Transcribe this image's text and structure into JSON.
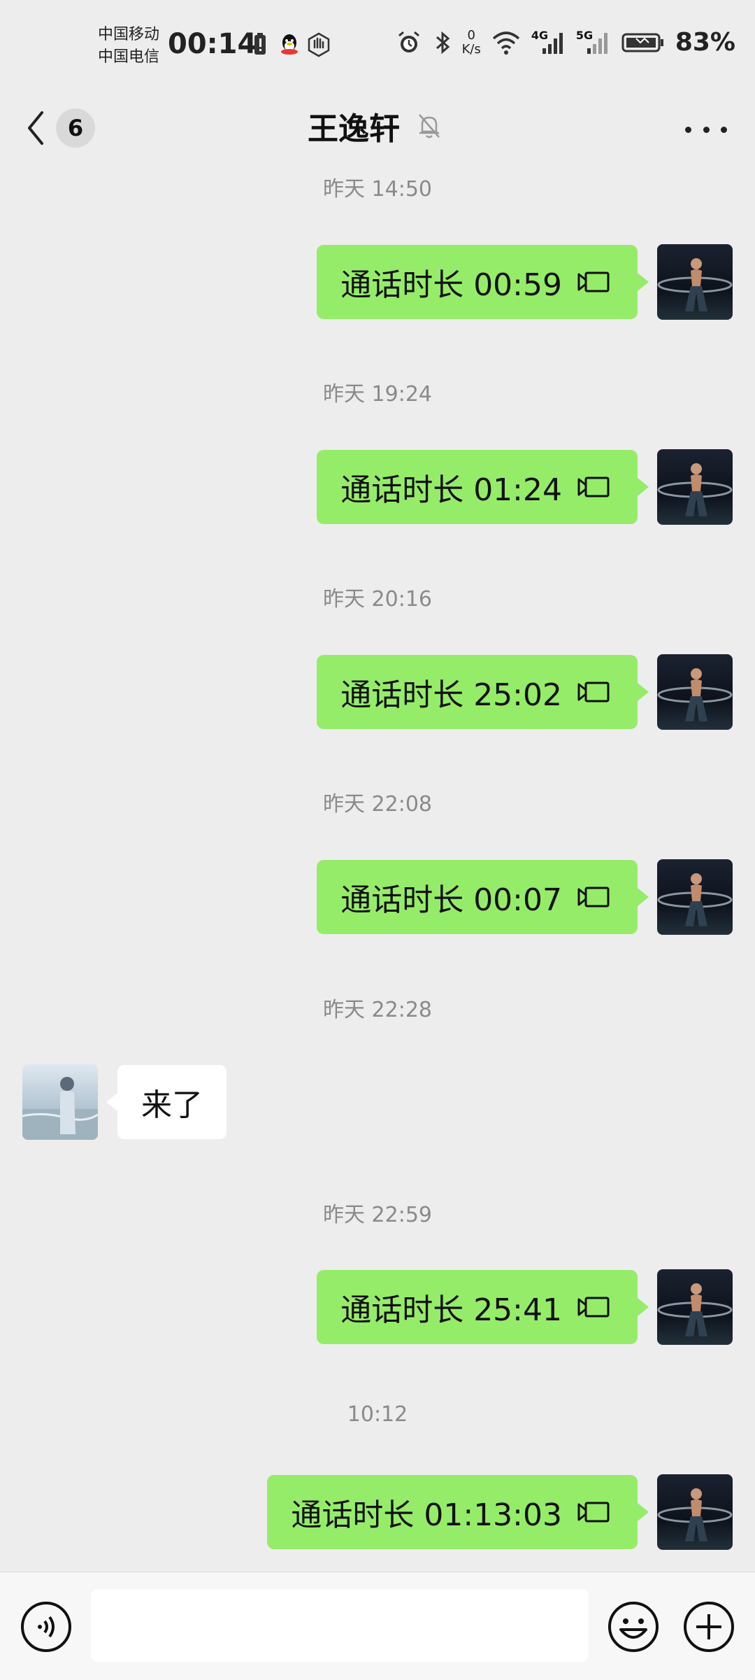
{
  "status_bar": {
    "carrier_1": "中国移动",
    "carrier_2": "中国电信",
    "time": "00:14",
    "net_speed_value": "0",
    "net_speed_unit": "K/s",
    "signal_1": "4G",
    "signal_2": "5G",
    "battery": "83%"
  },
  "header": {
    "back_count": "6",
    "title": "王逸轩",
    "muted_icon": "bell-off-icon",
    "more_icon": "more-dots-icon"
  },
  "messages": [
    {
      "timestamp": "昨天 14:50",
      "side": "right",
      "text": "通话时长 00:59",
      "icon": "video-call-icon"
    },
    {
      "timestamp": "昨天 19:24",
      "side": "right",
      "text": "通话时长 01:24",
      "icon": "video-call-icon"
    },
    {
      "timestamp": "昨天 20:16",
      "side": "right",
      "text": "通话时长 25:02",
      "icon": "video-call-icon"
    },
    {
      "timestamp": "昨天 22:08",
      "side": "right",
      "text": "通话时长 00:07",
      "icon": "video-call-icon"
    },
    {
      "timestamp": "昨天 22:28",
      "side": "left",
      "text": "来了"
    },
    {
      "timestamp": "昨天 22:59",
      "side": "right",
      "text": "通话时长 25:41",
      "icon": "video-call-icon"
    },
    {
      "timestamp": "10:12",
      "side": "right",
      "text": "通话时长 01:13:03",
      "icon": "video-call-icon"
    }
  ],
  "input_bar": {
    "voice_icon": "voice-mode-icon",
    "text_value": "",
    "emoji_icon": "emoji-icon",
    "plus_icon": "plus-icon"
  },
  "colors": {
    "background": "#EDEDED",
    "bubble_self": "#95EC69",
    "bubble_other": "#FFFFFF",
    "timestamp_text": "#8A8A8A"
  }
}
